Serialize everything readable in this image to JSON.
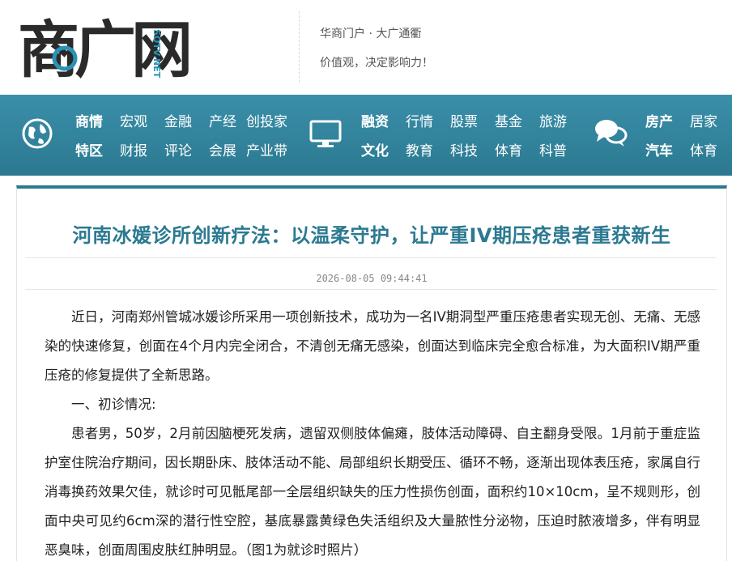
{
  "header": {
    "logo_text": "商广网",
    "logo_domain": "SQTV.NET",
    "slogan_line1": "华商门户 · 大广通衢",
    "slogan_line2": "价值观，决定影响力！"
  },
  "nav": {
    "group1": {
      "icon": "globe-icon",
      "row1": [
        "商情",
        "宏观",
        "金融",
        "产经",
        "创投家"
      ],
      "row2": [
        "特区",
        "财报",
        "评论",
        "会展",
        "产业带"
      ]
    },
    "group2": {
      "icon": "monitor-icon",
      "row1": [
        "融资",
        "行情",
        "股票",
        "基金",
        "旅游"
      ],
      "row2": [
        "文化",
        "教育",
        "科技",
        "体育",
        "科普"
      ]
    },
    "group3": {
      "icon": "chat-bubbles-icon",
      "row1": [
        "房产",
        "居家"
      ],
      "row2": [
        "汽车",
        "体育"
      ]
    }
  },
  "article": {
    "title": "河南冰媛诊所创新疗法：以温柔守护，让严重IV期压疮患者重获新生",
    "date": "2026-08-05 09:44:41",
    "paragraphs": [
      "近日，河南郑州管城冰媛诊所采用一项创新技术，成功为一名IV期洞型严重压疮患者实现无创、无痛、无感染的快速修复，创面在4个月内完全闭合，不清创无痛无感染，创面达到临床完全愈合标准，为大面积IV期严重压疮的修复提供了全新思路。",
      "一、初诊情况:",
      "患者男，50岁，2月前因脑梗死发病，遗留双侧肢体偏瘫，肢体活动障碍、自主翻身受限。1月前于重症监护室住院治疗期间，因长期卧床、肢体活动不能、局部组织长期受压、循环不畅，逐渐出现体表压疮，家属自行消毒换药效果欠佳，就诊时可见骶尾部一全层组织缺失的压力性损伤创面，面积约10×10cm，呈不规则形，创面中央可见约6cm深的潜行性空腔，基底暴露黄绿色失活组织及大量脓性分泌物，压迫时脓液增多，伴有明显恶臭味，创面周围皮肤红肿明显。（图1为就诊时照片）"
    ]
  },
  "colors": {
    "brand": "#2b7991",
    "logo_dark": "#2a2a2a",
    "logo_accent": "#2a92b5"
  }
}
